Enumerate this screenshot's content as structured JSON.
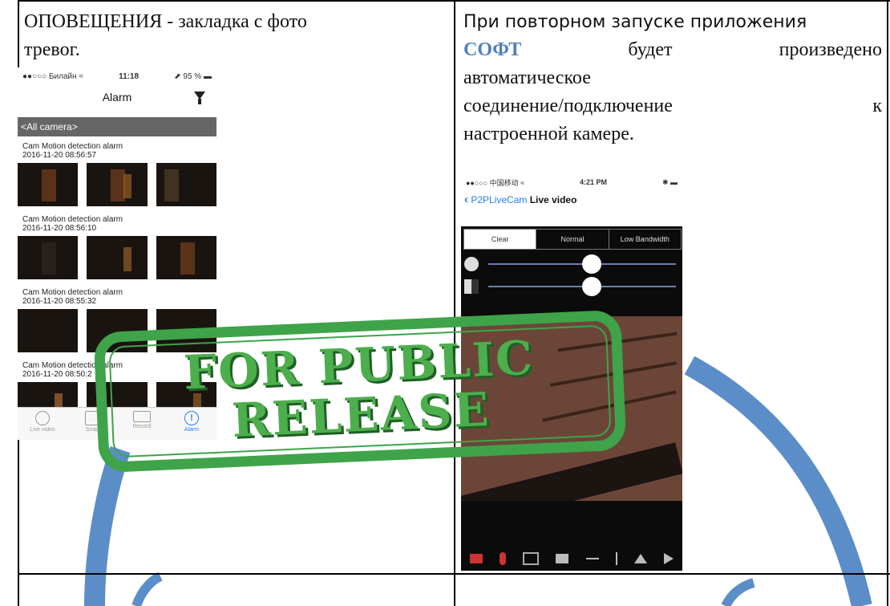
{
  "left_cell": {
    "text_line1": "ОПОВЕЩЕНИЯ - закладка с фото",
    "text_line2": "тревог."
  },
  "right_cell": {
    "line1": "При повторном запуске приложения",
    "line2_soft": "СОФТ",
    "line2_w2": "будет",
    "line2_w3": "произведено",
    "line3": "автоматическое",
    "line4_a": "соединение/подключение",
    "line4_b": "к",
    "line5": "настроенной камере."
  },
  "phone_alarm": {
    "status_carrier": "●●○○○ Билайн ≈",
    "status_time": "11:18",
    "status_battery": "⬈ 95 % ▬",
    "nav_title": "Alarm",
    "camera_selector": "<All camera>",
    "alarms": [
      {
        "title": "Cam Motion detection alarm",
        "time": "2016-11-20 08:56:57"
      },
      {
        "title": "Cam Motion detection alarm",
        "time": "2016-11-20 08:56:10"
      },
      {
        "title": "Cam Motion detection alarm",
        "time": "2016-11-20 08:55:32"
      },
      {
        "title": "Cam Motion detection alarm",
        "time": "2016-11-20 08:50:2"
      }
    ],
    "tabs": [
      {
        "label": "Live video"
      },
      {
        "label": "Snap"
      },
      {
        "label": "Record"
      },
      {
        "label": "Alarm"
      }
    ]
  },
  "phone_live": {
    "status_carrier": "●●○○○ 中国移动 ≈",
    "status_time": "4:21 PM",
    "status_battery": "✱ ▬",
    "back_label": "P2PLiveCam",
    "nav_title": "Live video",
    "quality_options": [
      "Clear",
      "Normal",
      "Low Bandwidth"
    ],
    "selected_quality": "Clear",
    "brightness_level": 0.55,
    "contrast_level": 0.55
  },
  "stamp": {
    "line1": "FOR PUBLIC",
    "line2": "RELEASE"
  },
  "colors": {
    "soft_accent": "#4f81bd",
    "stamp_green": "#3fa34a",
    "watermark_blue": "#5b8ec9",
    "ios_blue": "#2a7ef0"
  }
}
